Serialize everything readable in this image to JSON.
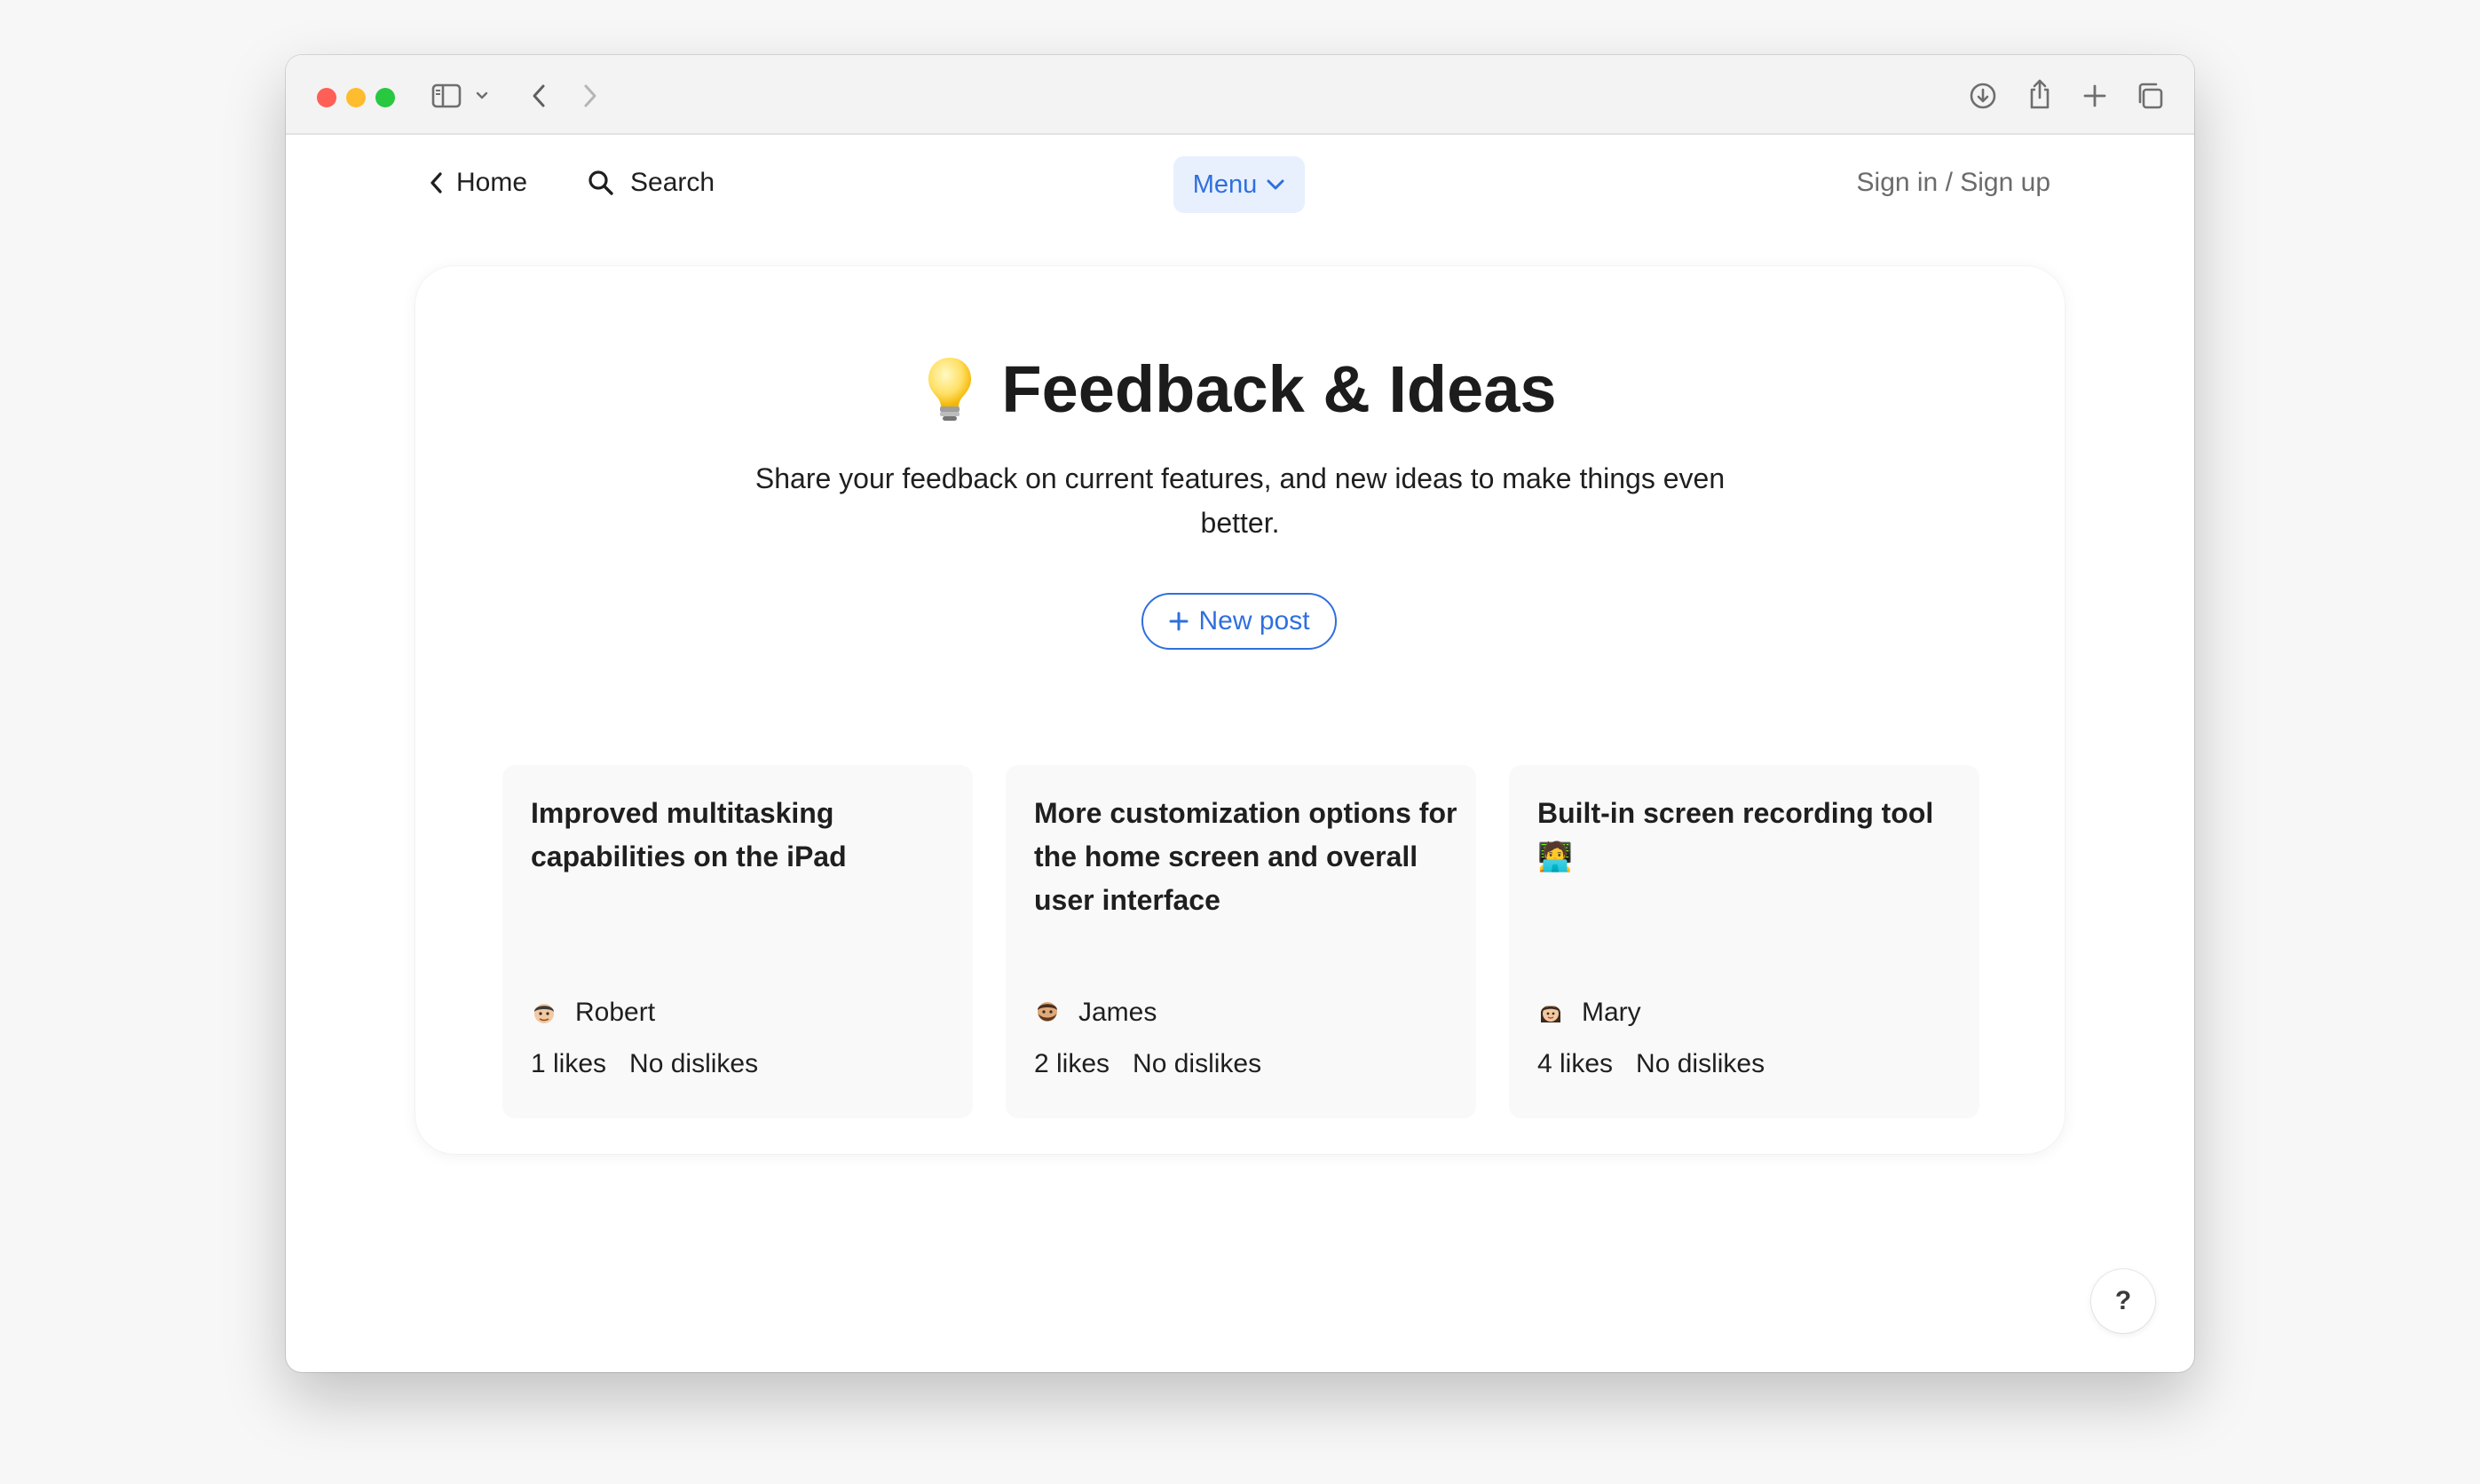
{
  "browser": {
    "icons": [
      "sidebar-icon",
      "chevron-down-icon",
      "back-icon",
      "forward-icon",
      "download-icon",
      "share-icon",
      "new-tab-icon",
      "tabs-overview-icon"
    ]
  },
  "nav": {
    "home_label": "Home",
    "search_label": "Search",
    "menu_label": "Menu",
    "signin_label": "Sign in / Sign up"
  },
  "page": {
    "title": "Feedback & Ideas",
    "subtitle": "Share your feedback on current features, and new ideas to make things even better.",
    "new_post_label": "New post"
  },
  "posts": [
    {
      "title": "Improved multitasking capabilities on the iPad",
      "author": "Robert",
      "likes": "1 likes",
      "dislikes": "No dislikes"
    },
    {
      "title": "More customization options for the home screen and overall user interface",
      "author": "James",
      "likes": "2 likes",
      "dislikes": "No dislikes"
    },
    {
      "title": "Built-in screen recording tool 🧑‍💻",
      "author": "Mary",
      "likes": "4 likes",
      "dislikes": "No dislikes"
    }
  ],
  "help": {
    "label": "?"
  },
  "colors": {
    "accent": "#2f6fde",
    "menu_bg": "#e8f0fe",
    "card_bg": "#f9f9f9",
    "text": "#1f1f1f",
    "muted": "#6b6b6b"
  }
}
